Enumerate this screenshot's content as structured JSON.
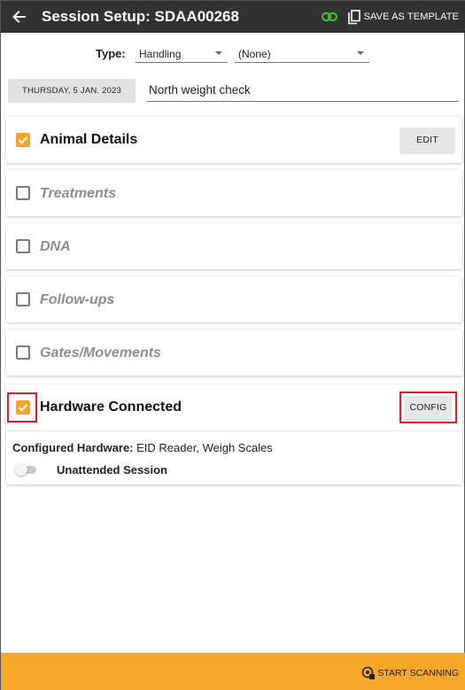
{
  "appbar": {
    "title": "Session Setup: SDAA00268",
    "save_template_label": "SAVE AS TEMPLATE"
  },
  "type_row": {
    "label": "Type:",
    "type_value": "Handling",
    "subtype_value": "(None)"
  },
  "date_row": {
    "date_label": "THURSDAY, 5 JAN. 2023",
    "description_value": "North weight check"
  },
  "sections": {
    "animal_details": {
      "label": "Animal Details",
      "checked": true,
      "button_label": "EDIT"
    },
    "treatments": {
      "label": "Treatments",
      "checked": false
    },
    "dna": {
      "label": "DNA",
      "checked": false
    },
    "follow_ups": {
      "label": "Follow-ups",
      "checked": false
    },
    "gates": {
      "label": "Gates/Movements",
      "checked": false
    },
    "hardware": {
      "label": "Hardware Connected",
      "checked": true,
      "button_label": "CONFIG",
      "configured_label": "Configured Hardware:",
      "configured_value": "EID Reader, Weigh Scales",
      "unattended_label": "Unattended Session",
      "unattended_on": false
    }
  },
  "bottombar": {
    "start_label": "START SCANNING"
  },
  "colors": {
    "appbar": "#323232",
    "accent": "#f0a52c",
    "bottombar": "#f8a829",
    "link_icon": "#3ec43e",
    "highlight": "#e41b23"
  },
  "icons": {
    "back": "arrow-left-icon",
    "link": "link-icon",
    "copy": "copy-icon",
    "scan": "scan-icon"
  }
}
